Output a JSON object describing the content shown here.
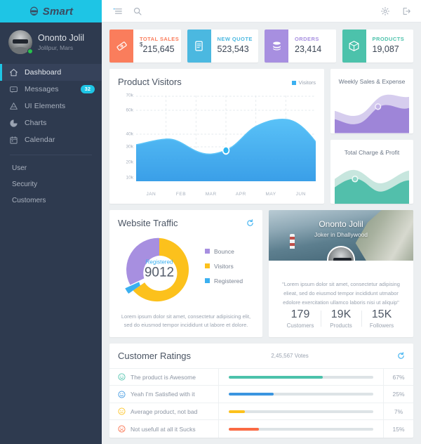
{
  "sidebar": {
    "logo_text": "Smart",
    "logo_icon": "face-sunglasses-icon",
    "profile": {
      "name": "Ononto Jolil",
      "location": "Jolilpur, Mars",
      "status": "online"
    },
    "nav": [
      {
        "label": "Dashboard",
        "icon": "home-icon",
        "active": true,
        "badge": ""
      },
      {
        "label": "Messages",
        "icon": "message-icon",
        "active": false,
        "badge": "32"
      },
      {
        "label": "UI Elements",
        "icon": "layers-icon",
        "active": false,
        "badge": ""
      },
      {
        "label": "Charts",
        "icon": "pie-chart-icon",
        "active": false,
        "badge": ""
      },
      {
        "label": "Calendar",
        "icon": "calendar-icon",
        "active": false,
        "badge": ""
      }
    ],
    "sub_links": [
      "User",
      "Security",
      "Customers"
    ]
  },
  "topbar": {
    "menu_icon": "hamburger-menu-icon",
    "search_icon": "search-icon",
    "settings_icon": "gear-icon",
    "logout_icon": "logout-icon"
  },
  "stats": [
    {
      "label": "TOTAL SALES",
      "value": "215,645",
      "prefix": "$",
      "color": "#fa7d5c",
      "icon": "ticket-icon"
    },
    {
      "label": "NEW QUOTE",
      "value": "523,543",
      "prefix": "",
      "color": "#4bb8e0",
      "icon": "document-icon"
    },
    {
      "label": "ORDERS",
      "value": "23,414",
      "prefix": "",
      "color": "#a78fe0",
      "icon": "database-icon"
    },
    {
      "label": "PRODUCTS",
      "value": "19,087",
      "prefix": "",
      "color": "#4cc2ab",
      "icon": "box-icon"
    }
  ],
  "visitors": {
    "title": "Product Visitors",
    "legend_label": "Visitors",
    "legend_color": "#3bb0f0"
  },
  "mini_charts": [
    {
      "title": "Weekly Sales & Expense",
      "back_color": "#d6cdee",
      "front_color": "#9e85d8",
      "dot_color": "#f0ecf9"
    },
    {
      "title": "Total Charge & Profit",
      "back_color": "#c7e6de",
      "front_color": "#52bfab",
      "dot_color": "#eaf7f3"
    }
  ],
  "traffic": {
    "title": "Website Traffic",
    "refresh_icon": "refresh-icon",
    "center_label": "Registered",
    "center_value": "9012",
    "note": "Lorem ipsum dolor sit amet, consectetur adipisicing elit, sed do eiusmod tempor incididunt ut labore et dolore.",
    "legend": [
      {
        "label": "Bounce",
        "color": "#a78fe0"
      },
      {
        "label": "Visitors",
        "color": "#fcc11c"
      },
      {
        "label": "Registered",
        "color": "#3bb0f0"
      }
    ]
  },
  "profile_card": {
    "name": "Ononto Jolil",
    "role": "Joker in Dhallywood",
    "quote": "\"Lorem ipsum dolor sit amet, consectetur adipising elieat, sed do eiusmod tempor incididunt utmabor edolore exercitation ullamco laboris nisi ut aliquip\"",
    "stats": [
      {
        "value": "179",
        "label": "Customers"
      },
      {
        "value": "19K",
        "label": "Products"
      },
      {
        "value": "15K",
        "label": "Followers"
      }
    ]
  },
  "ratings": {
    "title": "Customer Ratings",
    "votes": "2,45,567 Votes",
    "refresh_icon": "refresh-icon",
    "rows": [
      {
        "label": "The product is Awesome",
        "percent": "67%",
        "fill": 65,
        "color": "#4cc2ab",
        "icon": "smiley-happy-icon"
      },
      {
        "label": "Yeah I'm Satisfied with it",
        "percent": "25%",
        "fill": 31,
        "color": "#3b95e0",
        "icon": "smiley-neutral-icon"
      },
      {
        "label": "Average product, not bad",
        "percent": "7%",
        "fill": 11,
        "color": "#fcc11c",
        "icon": "smiley-meh-icon"
      },
      {
        "label": "Not usefull at all it Sucks",
        "percent": "15%",
        "fill": 21,
        "color": "#fa6a44",
        "icon": "smiley-sad-icon"
      }
    ]
  },
  "chart_data": [
    {
      "type": "area",
      "title": "Product Visitors",
      "categories": [
        "JAN",
        "FEB",
        "MAR",
        "APR",
        "MAY",
        "JUN"
      ],
      "series": [
        {
          "name": "Visitors",
          "values": [
            32000,
            34500,
            28500,
            30500,
            38000,
            40000
          ]
        }
      ],
      "ylabel": "",
      "xlabel": "",
      "ytick_labels": [
        "70k",
        "60k",
        "40k",
        "30k",
        "20k",
        "10k"
      ],
      "ytick_values": [
        70000,
        60000,
        40000,
        30000,
        20000,
        10000
      ],
      "ylim": [
        0,
        73000
      ],
      "grid": true,
      "legend_position": "top-right",
      "highlight_point": {
        "x": "APR",
        "y": 30500
      },
      "color": "#3bb0f0"
    },
    {
      "type": "area",
      "title": "Weekly Sales & Expense",
      "series": [
        {
          "name": "Sales",
          "values": [
            38,
            30,
            26,
            38,
            62,
            70,
            58,
            48,
            60
          ]
        },
        {
          "name": "Expense",
          "values": [
            55,
            48,
            40,
            52,
            76,
            86,
            74,
            62,
            78
          ]
        }
      ],
      "grid": false,
      "legend_position": "none",
      "colors": [
        "#9e85d8",
        "#d6cdee"
      ]
    },
    {
      "type": "area",
      "title": "Total Charge & Profit",
      "series": [
        {
          "name": "Profit",
          "values": [
            34,
            48,
            58,
            44,
            30,
            40,
            56,
            66,
            58
          ]
        },
        {
          "name": "Charge",
          "values": [
            52,
            66,
            74,
            60,
            48,
            58,
            72,
            82,
            76
          ]
        }
      ],
      "grid": false,
      "legend_position": "none",
      "colors": [
        "#52bfab",
        "#c7e6de"
      ]
    },
    {
      "type": "pie",
      "title": "Website Traffic",
      "labels": [
        "Bounce",
        "Visitors",
        "Registered"
      ],
      "values": [
        28,
        58,
        14
      ],
      "colors": [
        "#a78fe0",
        "#fcc11c",
        "#3bb0f0"
      ],
      "donut": true,
      "center_label": "Registered",
      "center_value": "9012",
      "legend_position": "right"
    },
    {
      "type": "bar",
      "title": "Customer Ratings",
      "categories": [
        "The product is Awesome",
        "Yeah I'm Satisfied with it",
        "Average product, not bad",
        "Not usefull at all it Sucks"
      ],
      "values": [
        67,
        25,
        7,
        15
      ],
      "colors": [
        "#4cc2ab",
        "#3b95e0",
        "#fcc11c",
        "#fa6a44"
      ],
      "xlabel": "",
      "ylabel": "",
      "ylim": [
        0,
        100
      ],
      "orientation": "horizontal",
      "grid": false,
      "legend_position": "none"
    }
  ]
}
